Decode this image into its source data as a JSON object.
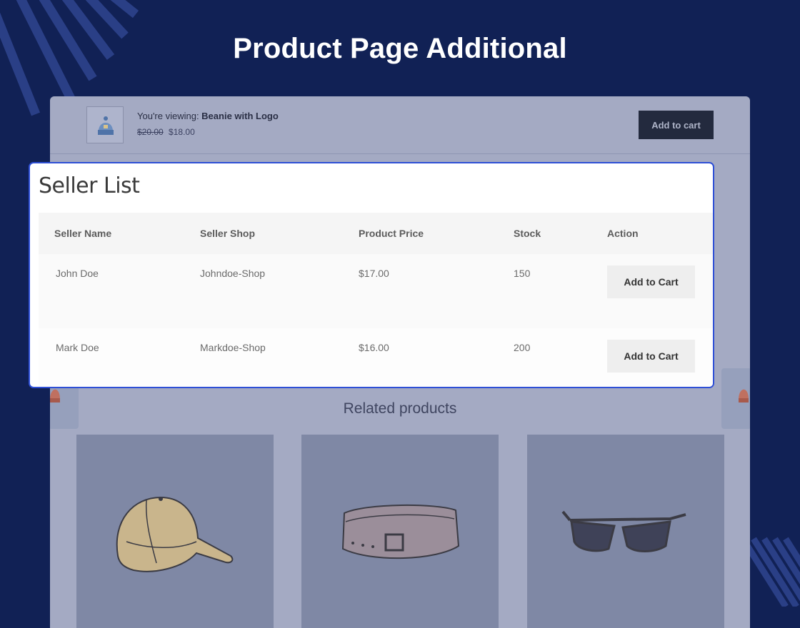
{
  "banner": {
    "title": "Product Page Additional"
  },
  "sticky_bar": {
    "viewing_prefix": "You're viewing: ",
    "product_name": "Beanie with Logo",
    "old_price": "$20.00",
    "new_price": "$18.00",
    "cart_label": "Add to cart"
  },
  "seller_list": {
    "title": "Seller List",
    "columns": [
      "Seller Name",
      "Seller Shop",
      "Product Price",
      "Stock",
      "Action"
    ],
    "rows": [
      {
        "name": "John Doe",
        "shop": "Johndoe-Shop",
        "price": "$17.00",
        "stock": "150",
        "action": "Add to Cart"
      },
      {
        "name": "Mark Doe",
        "shop": "Markdoe-Shop",
        "price": "$16.00",
        "stock": "200",
        "action": "Add to Cart"
      }
    ]
  },
  "related": {
    "title": "Related products",
    "items": [
      "cap-image",
      "belt-image",
      "sunglasses-image"
    ]
  },
  "colors": {
    "background": "#112155",
    "highlight_border": "#2e4fd6",
    "panel_overlay": "#a4aac3"
  }
}
